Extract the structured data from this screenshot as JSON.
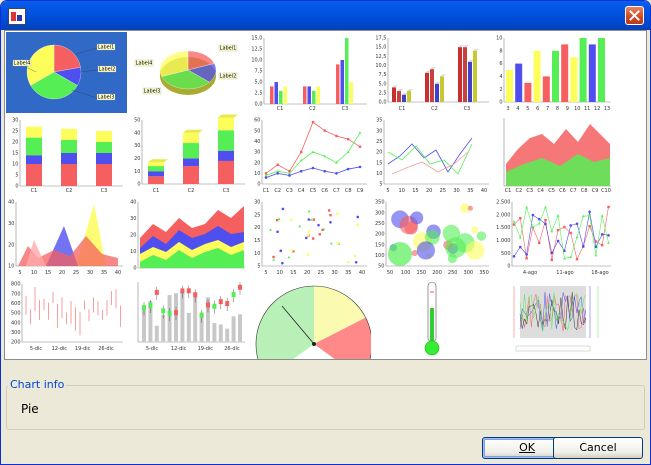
{
  "window": {
    "title": ""
  },
  "gallery": {
    "selected": "pie",
    "tiles": [
      {
        "kind": "pie",
        "labels": [
          "Label1",
          "Label2",
          "Label3",
          "Label4"
        ]
      },
      {
        "kind": "pie-3d",
        "labels": [
          "Label1",
          "Label2",
          "Label3",
          "Label4"
        ]
      },
      {
        "kind": "bar",
        "yticks": [
          "15,0",
          "12,5",
          "10,0",
          "7,5",
          "5,0",
          "2,5",
          "0,0"
        ],
        "xticks": [
          "C1",
          "C2",
          "C3"
        ]
      },
      {
        "kind": "bar-3d",
        "yticks": [
          "17,5",
          "15,0",
          "12,5",
          "10,0",
          "7,5",
          "5,0",
          "2,5",
          "0,0"
        ],
        "xticks": [
          "C1",
          "C2",
          "C3"
        ]
      },
      {
        "kind": "xy-bar",
        "yticks": [
          "10",
          "8",
          "6",
          "4",
          "2",
          "0"
        ],
        "xticks": [
          "3",
          "4",
          "5",
          "6",
          "7",
          "8",
          "9",
          "10",
          "11",
          "12",
          "13"
        ]
      },
      {
        "kind": "stacked-bar",
        "yticks": [
          "30",
          "25",
          "20",
          "15",
          "10",
          "5",
          "0"
        ],
        "xticks": [
          "C1",
          "C2",
          "C3"
        ]
      },
      {
        "kind": "stacked-bar-3d",
        "yticks": [
          "50",
          "40",
          "30",
          "20",
          "10",
          "0"
        ],
        "xticks": [
          "C1",
          "C2",
          "C3"
        ]
      },
      {
        "kind": "line",
        "yticks": [
          "60",
          "50",
          "40",
          "30",
          "20",
          "10",
          "0"
        ],
        "xticks": [
          "C1",
          "C2",
          "C3",
          "C4",
          "C5",
          "C6",
          "C7",
          "C8",
          "C9"
        ]
      },
      {
        "kind": "xy-line",
        "yticks": [
          "35",
          "30",
          "25",
          "20",
          "15",
          "10",
          "5"
        ],
        "xticks": [
          "5",
          "10",
          "15",
          "20",
          "25",
          "30",
          "35",
          "40"
        ]
      },
      {
        "kind": "area",
        "yticks": [],
        "xticks": [
          "C1",
          "C2",
          "C3",
          "C4",
          "C5",
          "C6",
          "C7",
          "C8",
          "C9",
          "C10"
        ]
      },
      {
        "kind": "xy-area",
        "yticks": [
          "40",
          "30",
          "20",
          "10"
        ],
        "xticks": [
          "5",
          "10",
          "15",
          "20",
          "25",
          "30",
          "35",
          "40"
        ]
      },
      {
        "kind": "stacked-area",
        "yticks": [
          "40",
          "30",
          "20",
          "10",
          "0"
        ],
        "xticks": []
      },
      {
        "kind": "scatter",
        "yticks": [
          "30",
          "25",
          "20",
          "15",
          "10",
          "5"
        ],
        "xticks": [
          "5",
          "10",
          "15",
          "20",
          "25",
          "30",
          "35",
          "40"
        ]
      },
      {
        "kind": "bubble",
        "yticks": [
          "350",
          "300",
          "250",
          "200",
          "150",
          "100",
          "50"
        ],
        "xticks": [
          "50",
          "100",
          "150",
          "200",
          "250",
          "300",
          "350"
        ]
      },
      {
        "kind": "time-series",
        "yticks": [
          "2.500",
          "2.000",
          "1.500",
          "1.000",
          "500",
          "0"
        ],
        "xticks": [
          "4-ago",
          "11-ago",
          "18-ago"
        ]
      },
      {
        "kind": "high-low",
        "yticks": [
          "800",
          "700",
          "600",
          "500",
          "400",
          "300",
          "200"
        ],
        "xticks": [
          "5-dic",
          "12-dic",
          "19-dic",
          "26-dic"
        ]
      },
      {
        "kind": "candlestick",
        "yticks": [],
        "xticks": [
          "5-dic",
          "12-dic",
          "19-dic",
          "26-dic"
        ]
      },
      {
        "kind": "meter",
        "yticks": [],
        "xticks": []
      },
      {
        "kind": "thermometer",
        "yticks": [],
        "xticks": []
      },
      {
        "kind": "multi-axis",
        "yticks": [],
        "xticks": []
      }
    ]
  },
  "info": {
    "legend": "Chart info",
    "value": "Pie"
  },
  "buttons": {
    "ok": "OK",
    "cancel": "Cancel"
  },
  "colors": {
    "red": "#f55f5f",
    "blue": "#4f4fef",
    "green": "#55ee55",
    "yellow": "#fdfd5c",
    "selection": "#3169c6",
    "title_blue": "#0046d5"
  }
}
